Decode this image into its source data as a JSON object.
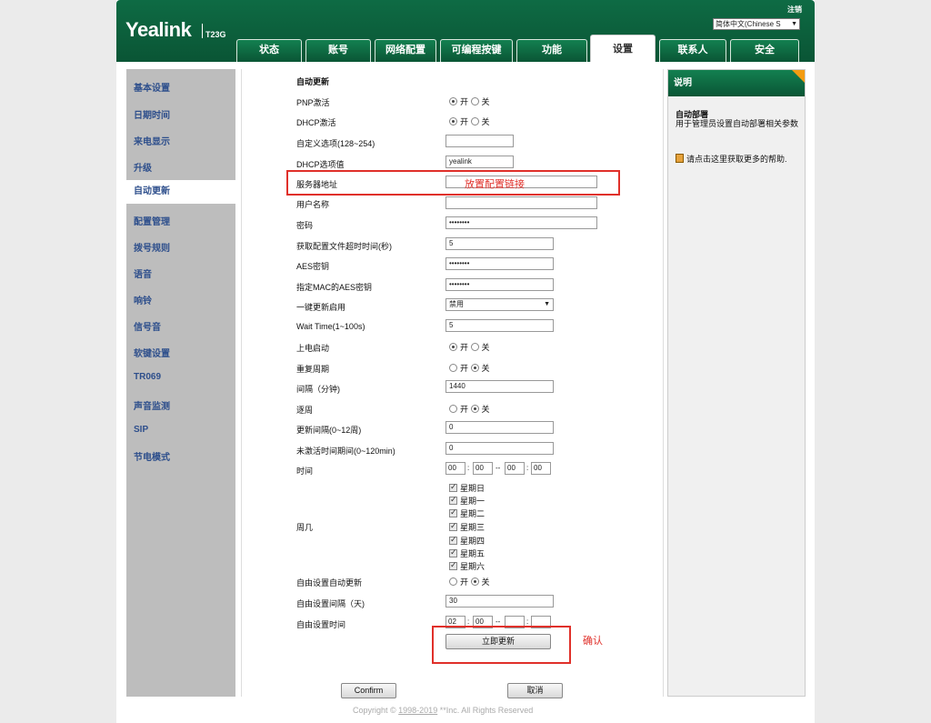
{
  "header": {
    "brand": "Yealink",
    "model": "T23G",
    "logout": "注销",
    "language": "简体中文(Chinese S",
    "tabs": [
      "状态",
      "账号",
      "网络配置",
      "可编程按键",
      "功能",
      "设置",
      "联系人",
      "安全"
    ],
    "active_tab": "设置"
  },
  "sidebar": {
    "items": [
      "基本设置",
      "日期时间",
      "来电显示",
      "升级",
      "自动更新",
      "配置管理",
      "拨号规则",
      "语音",
      "响铃",
      "信号音",
      "软键设置",
      "TR069",
      "声音监测",
      "SIP",
      "节电模式"
    ],
    "active": "自动更新"
  },
  "form": {
    "section_title": "自动更新",
    "pnp": {
      "label": "PNP激活",
      "on": "开",
      "off": "关",
      "value": "开"
    },
    "dhcp": {
      "label": "DHCP激活",
      "on": "开",
      "off": "关",
      "value": "开"
    },
    "custom_option": {
      "label": "自定义选项(128~254)",
      "value": ""
    },
    "dhcp_option_value": {
      "label": "DHCP选项值",
      "value": "yealink"
    },
    "server_url": {
      "label": "服务器地址",
      "value": ""
    },
    "username": {
      "label": "用户名称",
      "value": ""
    },
    "password": {
      "label": "密码",
      "value": "••••••••"
    },
    "timeout": {
      "label": "获取配置文件超时时间(秒)",
      "value": "5"
    },
    "aes_key": {
      "label": "AES密钥",
      "value": "••••••••"
    },
    "mac_aes_key": {
      "label": "指定MAC的AES密钥",
      "value": "••••••••"
    },
    "one_key_update": {
      "label": "一键更新启用",
      "value": "禁用"
    },
    "wait_time": {
      "label": "Wait Time(1~100s)",
      "value": "5"
    },
    "power_on": {
      "label": "上电启动",
      "on": "开",
      "off": "关",
      "value": "开"
    },
    "repeat": {
      "label": "重复周期",
      "on": "开",
      "off": "关",
      "value": "关"
    },
    "interval": {
      "label": "间隔（分钟)",
      "value": "1440"
    },
    "weekly": {
      "label": "逐周",
      "on": "开",
      "off": "关",
      "value": "关"
    },
    "update_interval_weeks": {
      "label": "更新间隔(0~12周)",
      "value": "0"
    },
    "inactive_time": {
      "label": "未激活时间期间(0~120min)",
      "value": "0"
    },
    "time": {
      "label": "时间",
      "start_h": "00",
      "start_m": "00",
      "end_h": "00",
      "end_m": "00",
      "colon": ":",
      "dash": "--"
    },
    "weekdays": {
      "label": "周几",
      "days": [
        "星期日",
        "星期一",
        "星期二",
        "星期三",
        "星期四",
        "星期五",
        "星期六"
      ]
    },
    "free_auto_update": {
      "label": "自由设置自动更新",
      "on": "开",
      "off": "关",
      "value": "关"
    },
    "free_interval_days": {
      "label": "自由设置间隔（天)",
      "value": "30"
    },
    "free_time": {
      "label": "自由设置时间",
      "start_h": "02",
      "start_m": "00",
      "end_h": "",
      "end_m": ""
    },
    "update_now": "立即更新",
    "confirm": "Confirm",
    "cancel": "取消"
  },
  "annotations": {
    "server_hint": "放置配置链接",
    "confirm_hint": "确认"
  },
  "help": {
    "header": "说明",
    "title": "自动部署",
    "desc": "用于管理员设置自动部署相关参数",
    "more": "请点击这里获取更多的帮助."
  },
  "footer": {
    "prefix": "Copyright © ",
    "years": "1998-2019",
    "suffix": " **Inc. All Rights Reserved"
  },
  "colors": {
    "brand_green": "#0a5535",
    "accent_orange": "#f39c12",
    "annotation_red": "#e0302a"
  }
}
